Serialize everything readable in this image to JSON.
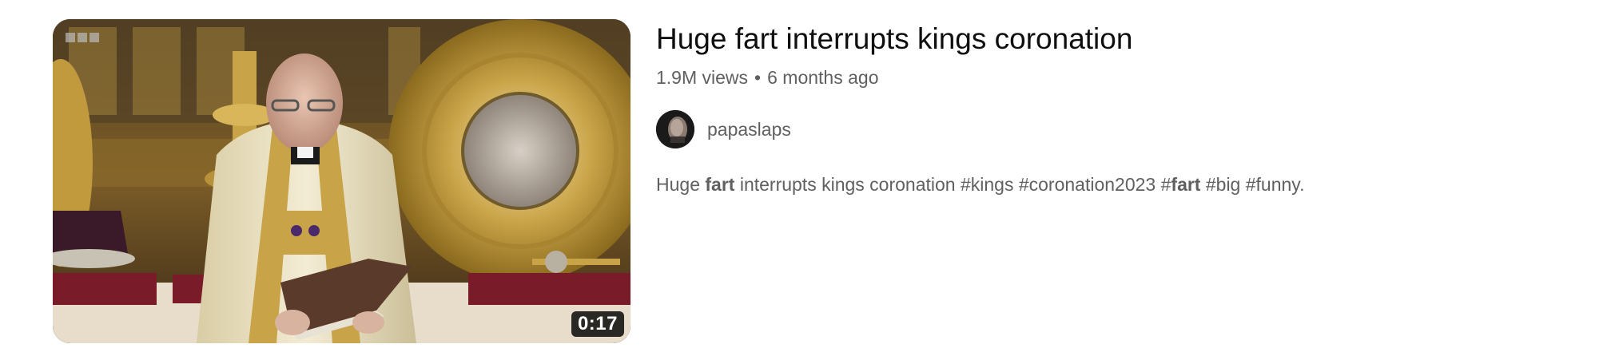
{
  "video": {
    "duration": "0:17",
    "title": "Huge fart interrupts kings coronation",
    "views": "1.9M views",
    "separator": "•",
    "age": "6 months ago",
    "channel": {
      "name": "papaslaps"
    },
    "description": {
      "segments": [
        {
          "text": "Huge ",
          "bold": false
        },
        {
          "text": "fart",
          "bold": true
        },
        {
          "text": " interrupts kings coronation #kings #coronation2023 #",
          "bold": false
        },
        {
          "text": "fart",
          "bold": true
        },
        {
          "text": " #big #funny.",
          "bold": false
        }
      ]
    }
  },
  "colors": {
    "title": "#0f0f0f",
    "secondary_text": "#606060",
    "duration_badge_bg": "#000000"
  },
  "icons": {
    "thumbnail": "video-thumbnail-image",
    "avatar": "channel-avatar-image"
  }
}
